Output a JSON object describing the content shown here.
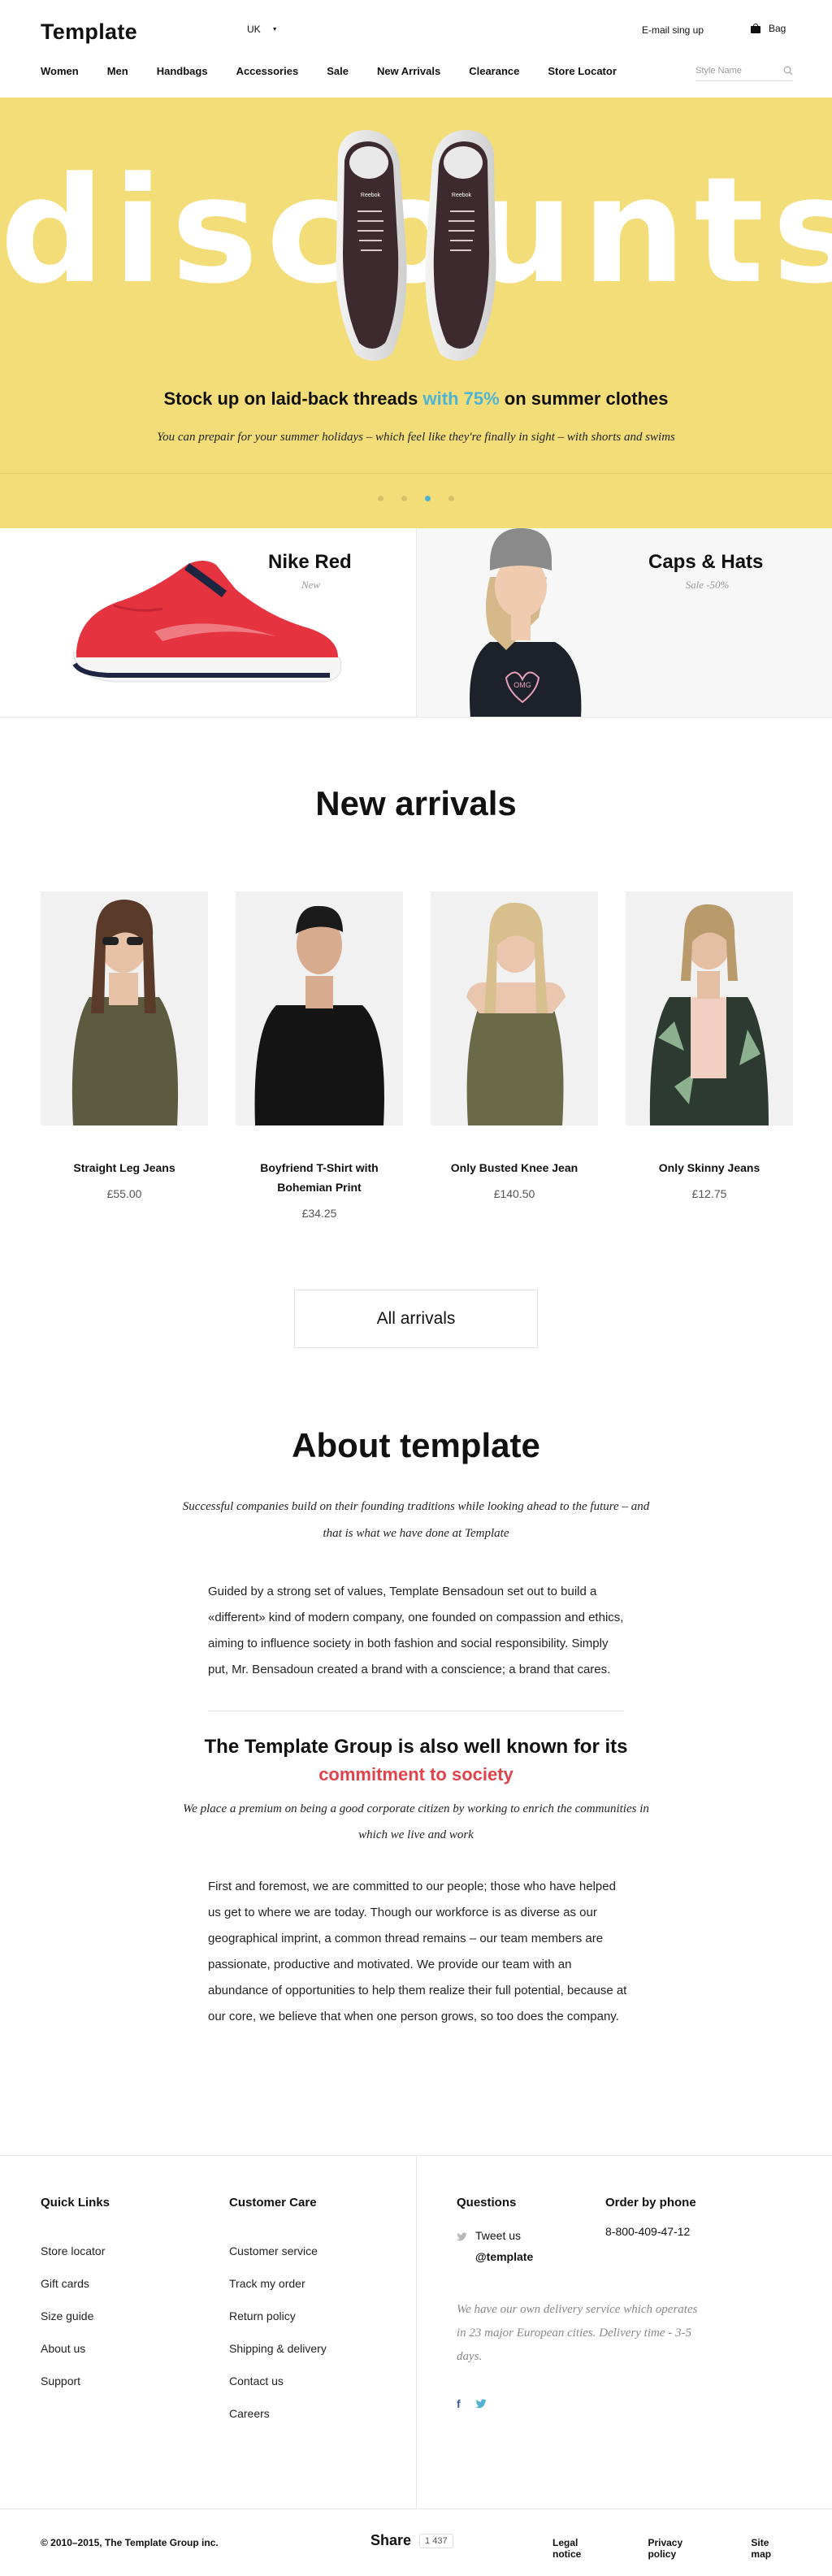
{
  "header": {
    "logo": "Template",
    "region": "UK",
    "signup": "E-mail sing up",
    "bag": "Bag",
    "nav": [
      "Women",
      "Men",
      "Handbags",
      "Accessories",
      "Sale",
      "New Arrivals",
      "Clearance",
      "Store Locator"
    ],
    "search_placeholder": "Style Name"
  },
  "hero": {
    "word": "discounts",
    "headline_pre": "Stock up on laid-back threads ",
    "headline_highlight": "with 75%",
    "headline_post": " on summer clothes",
    "subline": "You can prepair for your summer holidays – which feel like they're finally in sight – with shorts and swims",
    "shoe_brand": "Reebok",
    "slides": 4,
    "active_slide": 3,
    "colors": {
      "background": "#f3dd79",
      "highlight": "#4fb3d3"
    }
  },
  "promos": [
    {
      "title": "Nike Red",
      "subtitle": "New"
    },
    {
      "title": "Caps & Hats",
      "subtitle": "Sale -50%",
      "shirt_text": "OMG"
    }
  ],
  "arrivals": {
    "title": "New arrivals",
    "products": [
      {
        "name": "Straight Leg Jeans",
        "price": "£55.00"
      },
      {
        "name": "Boyfriend T-Shirt with Bohemian Print",
        "price": "£34.25"
      },
      {
        "name": "Only Busted Knee Jean",
        "price": "£140.50"
      },
      {
        "name": "Only Skinny Jeans",
        "price": "£12.75"
      }
    ],
    "all_button": "All arrivals"
  },
  "about": {
    "title": "About template",
    "intro": "Successful companies build on their founding traditions while looking ahead to the future – and that is what we have done at Template",
    "paragraph1": "Guided by a strong set of values, Template Bensadoun set out to build a «different» kind of modern company, one founded on compassion and ethics, aiming to influence society in both fashion and social responsibility. Simply put, Mr. Bensadoun created a brand with a conscience; a brand that cares.",
    "group_title": "The Template Group is also well known for its",
    "group_highlight": "commitment to society",
    "group_intro": "We place a premium on being a good corporate citizen by working to enrich the communities in which we live and work",
    "paragraph2": "First and foremost, we are committed to our people; those who have helped us get to where we are today. Though our workforce is as diverse as our geographical imprint, a common thread remains – our team members are passionate, productive and motivated. We provide our team with an abundance of opportunities to help them realize their full potential, because at our core, we believe that when one person grows, so too does the company.",
    "accent_color": "#e0434b"
  },
  "footer": {
    "quick_links_title": "Quick Links",
    "quick_links": [
      "Store locator",
      "Gift cards",
      "Size guide",
      "About us",
      "Support"
    ],
    "customer_care_title": "Customer Care",
    "customer_care": [
      "Customer service",
      "Track my order",
      "Return policy",
      "Shipping & delivery",
      "Contact us",
      "Careers"
    ],
    "questions_title": "Questions",
    "tweet_label": "Tweet us",
    "tweet_handle": "@template",
    "phone_title": "Order by phone",
    "phone": "8-800-409-47-12",
    "delivery_note": "We have our own delivery service which operates in 23 major European cities. Delivery time - 3-5 days.",
    "social_facebook": "f",
    "copyright": "© 2010–2015, The Template Group inc.",
    "share_label": "Share",
    "share_count": "1 437",
    "legal": [
      "Legal notice",
      "Privacy policy",
      "Site map"
    ]
  }
}
